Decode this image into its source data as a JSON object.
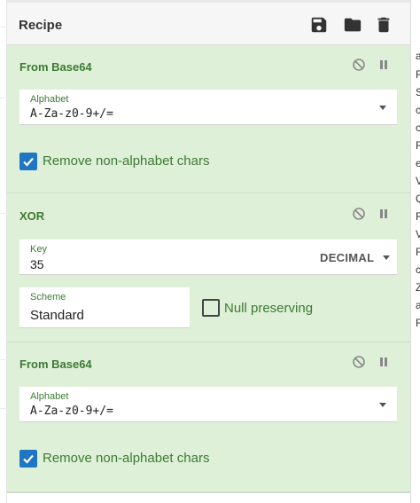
{
  "panel": {
    "title": "Recipe"
  },
  "header_icons": [
    {
      "name": "save-icon"
    },
    {
      "name": "folder-icon"
    },
    {
      "name": "trash-icon"
    }
  ],
  "operations": [
    {
      "title": "From Base64",
      "field": {
        "label": "Alphabet",
        "value": "A-Za-z0-9+/="
      },
      "checkbox": {
        "label": "Remove non-alphabet chars",
        "checked": true
      }
    },
    {
      "title": "XOR",
      "key": {
        "label": "Key",
        "value": "35",
        "format": "DECIMAL"
      },
      "scheme": {
        "label": "Scheme",
        "value": "Standard"
      },
      "checkbox": {
        "label": "Null preserving",
        "checked": false
      }
    },
    {
      "title": "From Base64",
      "field": {
        "label": "Alphabet",
        "value": "A-Za-z0-9+/="
      },
      "checkbox": {
        "label": "Remove non-alphabet chars",
        "checked": true
      }
    }
  ],
  "op_controls": [
    {
      "name": "disable-icon"
    },
    {
      "name": "pause-icon"
    }
  ],
  "right_panel_text": [
    "a",
    "R",
    "S",
    "c",
    "c",
    "R",
    "e",
    "V",
    "Q",
    "R",
    "V",
    "F",
    "c",
    "Z",
    "a",
    "F"
  ],
  "colors": {
    "op_background": "#dff0d8",
    "op_title": "#3d7a34",
    "checkbox_checked": "#1f76c2",
    "header_background": "#f6f6f6"
  }
}
